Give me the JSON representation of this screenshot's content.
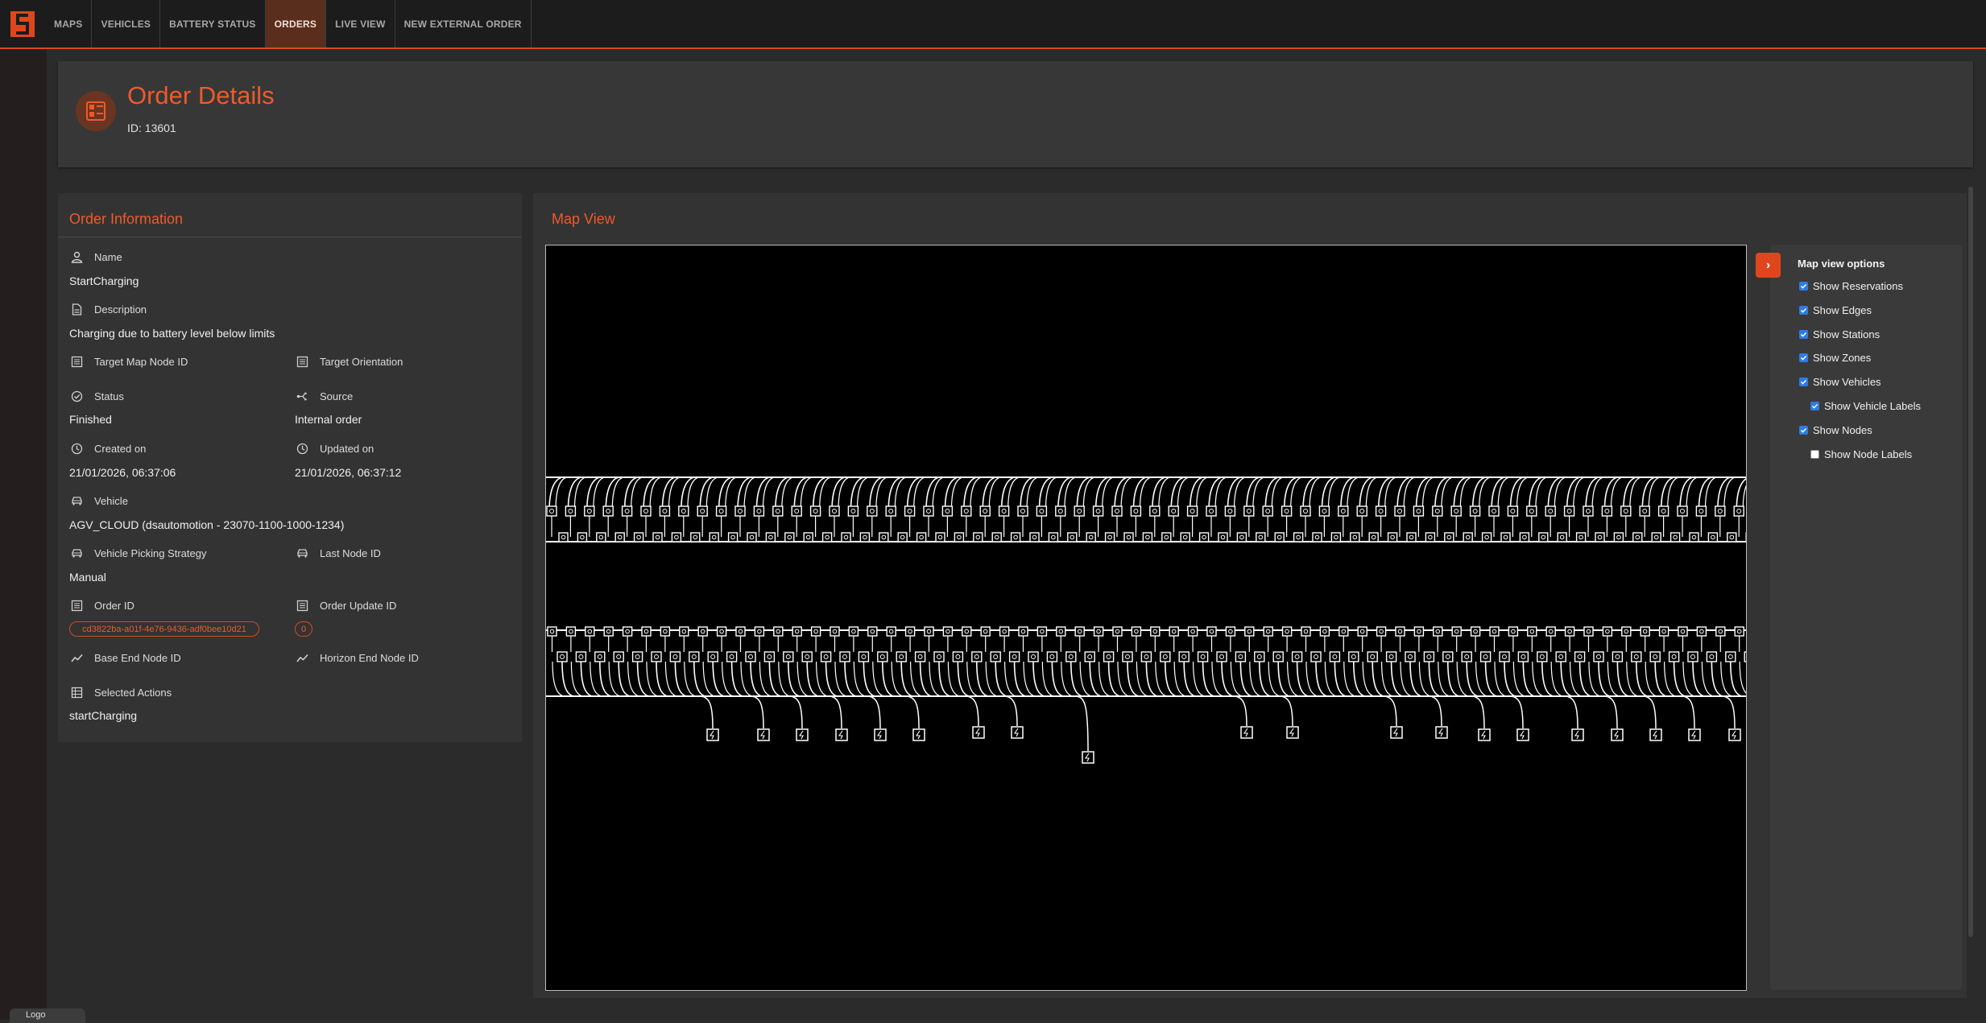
{
  "nav": {
    "tabs": [
      "MAPS",
      "VEHICLES",
      "BATTERY STATUS",
      "ORDERS",
      "LIVE VIEW",
      "NEW EXTERNAL ORDER"
    ],
    "active_tab": "ORDERS"
  },
  "header": {
    "title": "Order Details",
    "id_text": "ID: 13601"
  },
  "order_info": {
    "section_title": "Order Information",
    "name_label": "Name",
    "name_value": "StartCharging",
    "description_label": "Description",
    "description_value": "Charging due to battery level below limits",
    "target_node_label": "Target Map Node ID",
    "target_orientation_label": "Target Orientation",
    "status_label": "Status",
    "status_value": "Finished",
    "source_label": "Source",
    "source_value": "Internal order",
    "created_label": "Created on",
    "created_value": "21/01/2026, 06:37:06",
    "updated_label": "Updated on",
    "updated_value": "21/01/2026, 06:37:12",
    "vehicle_label": "Vehicle",
    "vehicle_value": "AGV_CLOUD (dsautomotion - 23070-1100-1000-1234)",
    "picking_label": "Vehicle Picking Strategy",
    "picking_value": "Manual",
    "last_node_label": "Last Node ID",
    "order_id_label": "Order ID",
    "order_id_value": "cd3822ba-a01f-4e76-9436-adf0bee10d21",
    "order_update_label": "Order Update ID",
    "order_update_value": "0",
    "base_end_label": "Base End Node ID",
    "horizon_end_label": "Horizon End Node ID",
    "selected_actions_label": "Selected Actions",
    "selected_actions_value": "startCharging"
  },
  "map_view": {
    "section_title": "Map View",
    "options_title": "Map view options",
    "options": [
      {
        "label": "Show Reservations",
        "checked": true,
        "indent": false
      },
      {
        "label": "Show Edges",
        "checked": true,
        "indent": false
      },
      {
        "label": "Show Stations",
        "checked": true,
        "indent": false
      },
      {
        "label": "Show Zones",
        "checked": true,
        "indent": false
      },
      {
        "label": "Show Vehicles",
        "checked": true,
        "indent": false
      },
      {
        "label": "Show Vehicle Labels",
        "checked": true,
        "indent": true
      },
      {
        "label": "Show Nodes",
        "checked": true,
        "indent": false
      },
      {
        "label": "Show Node Labels",
        "checked": false,
        "indent": true
      }
    ]
  },
  "footer": {
    "logout_label": "Logo"
  },
  "colors": {
    "accent": "#ef5a2a",
    "topbar": "#1c1c1c",
    "card": "#333333",
    "checkbox": "#2f7be6"
  }
}
